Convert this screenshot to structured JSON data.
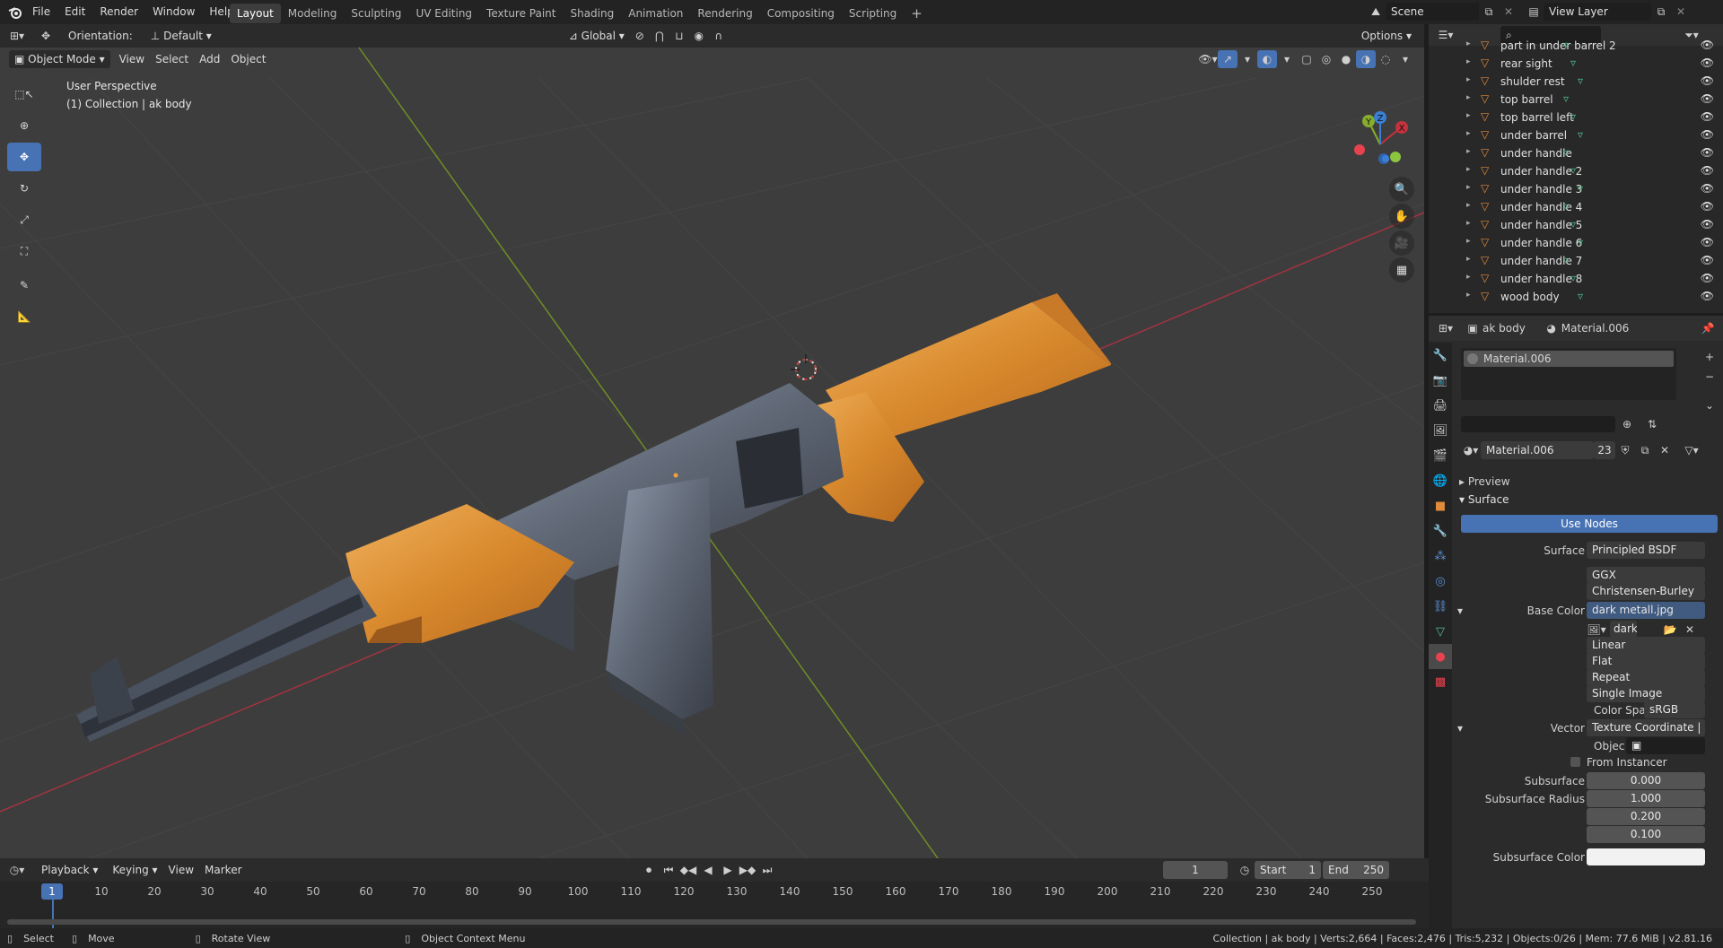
{
  "topbar": {
    "menus": [
      "File",
      "Edit",
      "Render",
      "Window",
      "Help"
    ],
    "workspaces": [
      "Layout",
      "Modeling",
      "Sculpting",
      "UV Editing",
      "Texture Paint",
      "Shading",
      "Animation",
      "Rendering",
      "Compositing",
      "Scripting"
    ],
    "active_workspace": "Layout",
    "scene": "Scene",
    "view_layer": "View Layer"
  },
  "tool_header": {
    "orientation_label": "Orientation:",
    "orientation_value": "Default",
    "transform_orientation": "Global",
    "options": "Options"
  },
  "viewport_header": {
    "mode": "Object Mode",
    "menus": [
      "View",
      "Select",
      "Add",
      "Object"
    ]
  },
  "viewport": {
    "perspective": "User Perspective",
    "collection_info": "(1) Collection | ak body",
    "gizmo_axes": [
      "X",
      "Y",
      "Z"
    ]
  },
  "outliner": {
    "search_placeholder": "",
    "items": [
      "part in under barrel 2",
      "rear sight",
      "shulder rest",
      "top barrel",
      "top barrel left",
      "under barrel",
      "under handle",
      "under handle 2",
      "under handle 3",
      "under handle 4",
      "under handle 5",
      "under handle 6",
      "under handle 7",
      "under handle 8",
      "wood body"
    ]
  },
  "properties": {
    "breadcrumb_object": "ak body",
    "breadcrumb_material": "Material.006",
    "slot_name": "Material.006",
    "material_name": "Material.006",
    "material_users": "23",
    "panels": {
      "preview": "Preview",
      "surface": "Surface"
    },
    "use_nodes": "Use Nodes",
    "rows": {
      "surface_label": "Surface",
      "surface_value": "Principled BSDF",
      "distribution": "GGX",
      "subsurface_method": "Christensen-Burley",
      "base_color_label": "Base Color",
      "base_color_value": "dark metall.jpg",
      "image_name": "dark",
      "interpolation": "Linear",
      "projection": "Flat",
      "extension": "Repeat",
      "source": "Single Image",
      "color_space_label": "Color Spac",
      "color_space_value": "sRGB",
      "vector_label": "Vector",
      "vector_value": "Texture Coordinate | ...",
      "object_label": "Objec",
      "from_instancer": "From Instancer",
      "subsurface_label": "Subsurface",
      "subsurface_value": "0.000",
      "subsurface_radius_label": "Subsurface Radius",
      "subsurface_radius": [
        "1.000",
        "0.200",
        "0.100"
      ],
      "subsurface_color_label": "Subsurface Color"
    }
  },
  "timeline": {
    "menus": [
      "Playback",
      "Keying",
      "View",
      "Marker"
    ],
    "current_frame": "1",
    "start_label": "Start",
    "start_value": "1",
    "end_label": "End",
    "end_value": "250",
    "ticks": [
      "10",
      "20",
      "30",
      "40",
      "50",
      "60",
      "70",
      "80",
      "90",
      "100",
      "110",
      "120",
      "130",
      "140",
      "150",
      "160",
      "170",
      "180",
      "190",
      "200",
      "210",
      "220",
      "230",
      "240",
      "250"
    ],
    "playhead_label": "1"
  },
  "statusbar": {
    "select": "Select",
    "move": "Move",
    "rotate_view": "Rotate View",
    "context_menu": "Object Context Menu",
    "stats": "Collection | ak body | Verts:2,664 | Faces:2,476 | Tris:5,232 | Objects:0/26 | Mem: 77.6 MiB | v2.81.16"
  },
  "colors": {
    "accent": "#4772b3",
    "x_axis": "#c6323e",
    "y_axis": "#86ad2b",
    "z_axis": "#3b7fd4",
    "object_orange": "#e08a3c",
    "mesh_green": "#4fc08d"
  }
}
